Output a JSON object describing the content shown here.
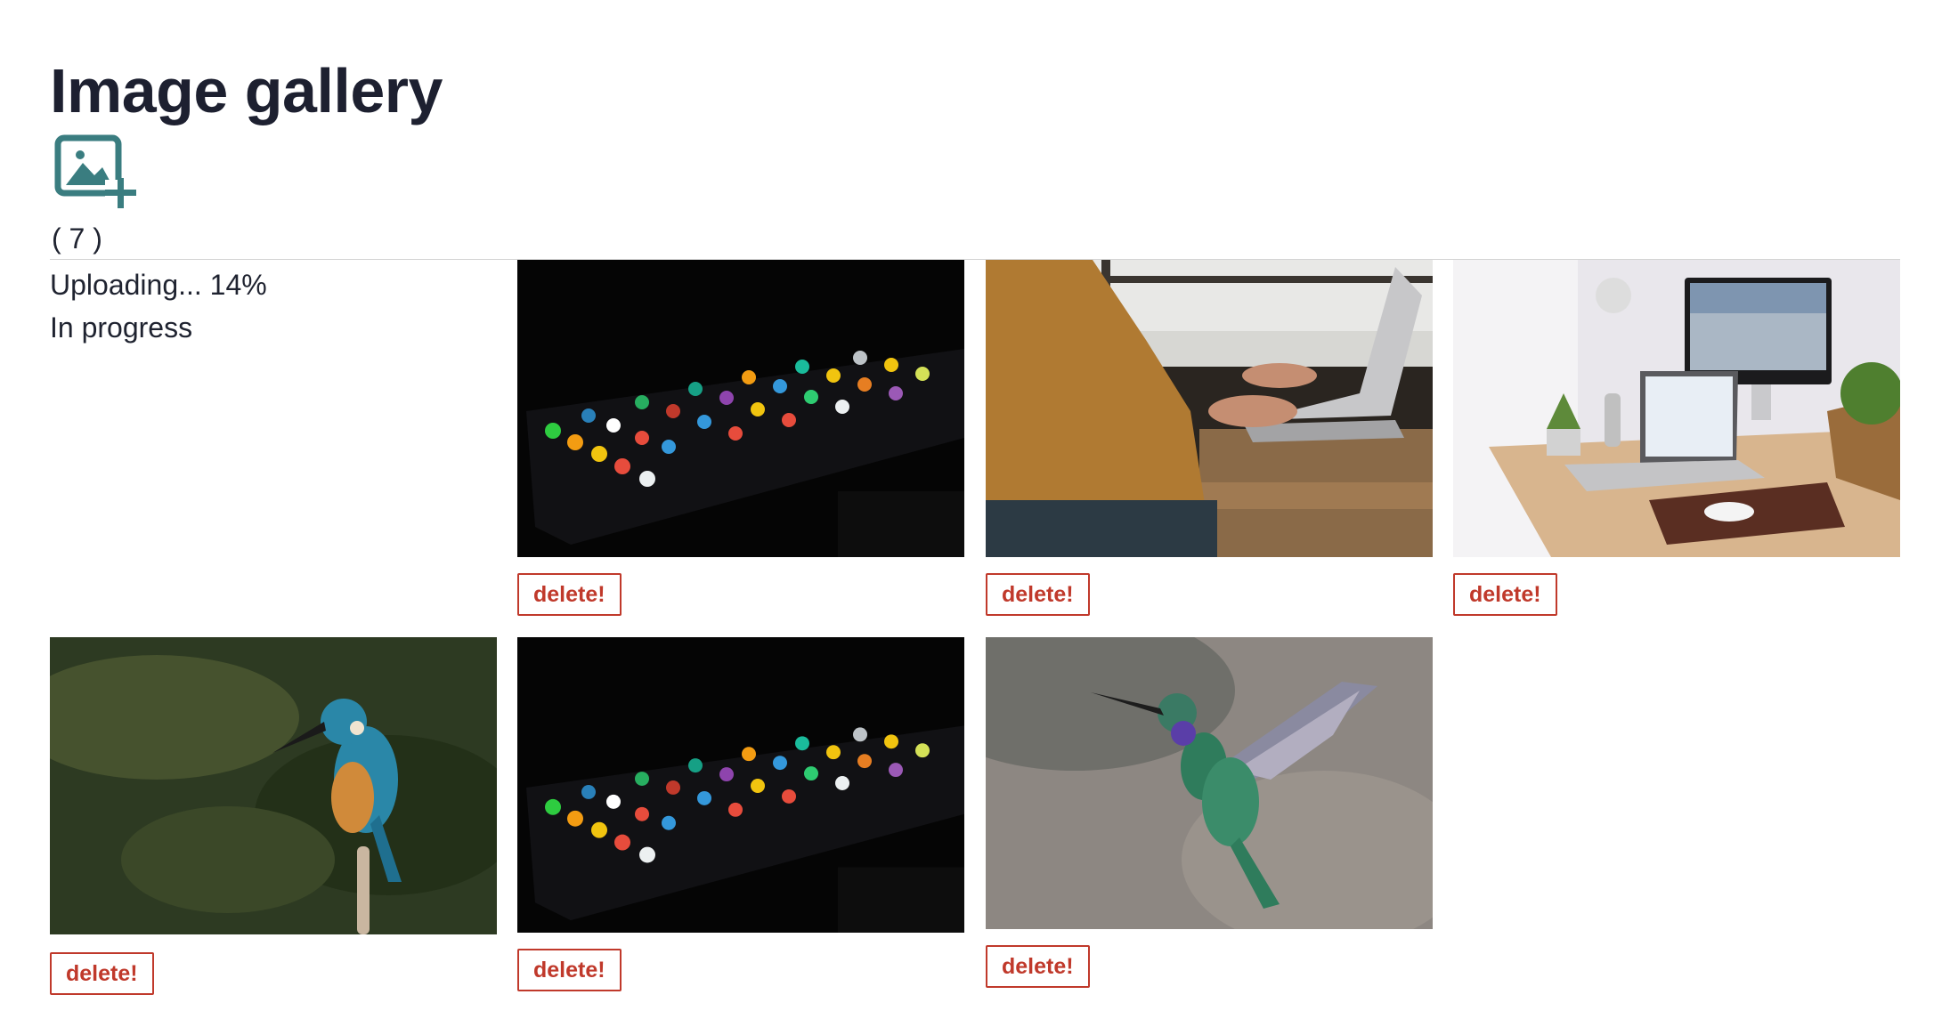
{
  "page": {
    "title": "Image gallery",
    "count_label": "( 7 )"
  },
  "upload": {
    "progress_text": "Uploading... 14%",
    "progress_percent": 14,
    "status_text": "In progress"
  },
  "actions": {
    "add_image_icon": "image-plus-icon",
    "delete_label": "delete!"
  },
  "gallery": {
    "images": [
      {
        "subject": "smartphone with app icons in the dark"
      },
      {
        "subject": "person typing on laptop at wooden desk"
      },
      {
        "subject": "desk with iMac, laptop and mouse"
      },
      {
        "subject": "kingfisher perched on branch"
      },
      {
        "subject": "smartphone with app icons in the dark"
      },
      {
        "subject": "hummingbird in flight"
      }
    ]
  },
  "colors": {
    "accent_teal": "#3a7d80",
    "delete_red": "#c0392b",
    "text_dark": "#1d2030"
  }
}
